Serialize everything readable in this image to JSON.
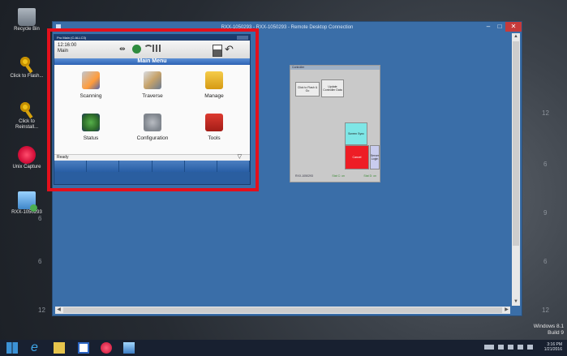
{
  "desktop": {
    "icons": [
      {
        "label": "Recycle Bin",
        "icon": "recycle-bin-icon"
      },
      {
        "label": "Click to Flash...",
        "icon": "key-icon"
      },
      {
        "label": "Click to Reinstall...",
        "icon": "key-icon"
      },
      {
        "label": "Unix Capture",
        "icon": "capture-icon"
      },
      {
        "label": "RXX-1050293",
        "icon": "remote-pc-icon"
      }
    ],
    "dial_numbers": [
      "12",
      "6",
      "9",
      "6",
      "6",
      "12",
      "6",
      "12"
    ],
    "watermark": {
      "line1": "Windows 8.1",
      "line2": "Build 9"
    }
  },
  "rdp_window": {
    "title": "RXX-1050293 - RXX-1050293 - Remote Desktop Connection",
    "minimize": "–",
    "maximize": "□",
    "close": "✕"
  },
  "device": {
    "titlebar": "Pro Main (C:ALLC3)",
    "time": "12:16:00",
    "mode": "Main",
    "header": "Main Menu",
    "tiles": [
      {
        "label": "Scanning",
        "icon": "scanning-icon"
      },
      {
        "label": "Traverse",
        "icon": "traverse-icon"
      },
      {
        "label": "Manage",
        "icon": "manage-folder-icon"
      },
      {
        "label": "Status",
        "icon": "status-icon"
      },
      {
        "label": "Configuration",
        "icon": "configuration-icon"
      },
      {
        "label": "Tools",
        "icon": "tools-icon"
      }
    ],
    "status_text": "Ready",
    "chevron": "▽"
  },
  "panel": {
    "title": "Controller",
    "buttons": {
      "b1": "Click to Flash & Go",
      "b2": "Update Controller Data",
      "b3": "Screen Sync",
      "b4": "Cancel",
      "b5": "Server Login"
    },
    "footer": {
      "left": "RXX-1050293",
      "right1": "Stat C: on",
      "right2": "Stat D: on"
    },
    "colors": {
      "cyan": "#7ee6e6",
      "red": "#ee1d25",
      "lavender": "#c9ccee"
    }
  },
  "taskbar": {
    "ie_glyph": "e",
    "tray_time": "3:16 PM",
    "tray_date": "1/21/2016"
  },
  "colors": {
    "highlight": "#e3101c",
    "rdp_bg": "#3a6ea8",
    "device_header": "#2c62b4"
  }
}
